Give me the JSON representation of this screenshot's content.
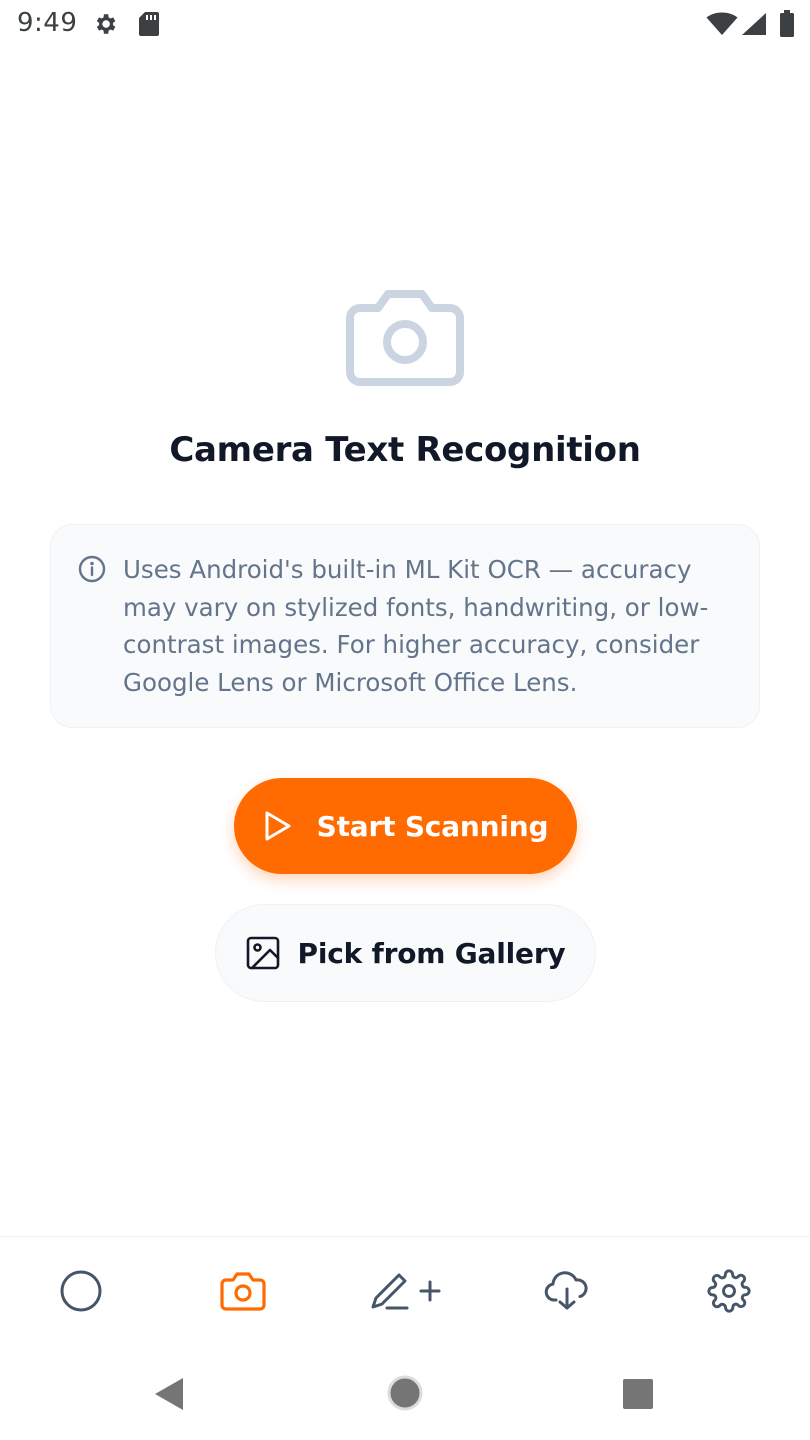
{
  "status_bar": {
    "time": "9:49",
    "icons": [
      "settings-gear-icon",
      "sd-card-icon",
      "wifi-icon",
      "signal-icon",
      "battery-icon"
    ]
  },
  "main": {
    "hero_icon": "camera-icon",
    "title": "Camera Text Recognition",
    "info": {
      "icon": "info-icon",
      "text": "Uses Android's built-in ML Kit OCR — accuracy may vary on stylized fonts, handwriting, or low-contrast images. For higher accuracy, consider Google Lens or Microsoft Office Lens."
    },
    "primary_button": {
      "label": "Start Scanning",
      "icon": "play-icon"
    },
    "secondary_button": {
      "label": "Pick from Gallery",
      "icon": "image-icon"
    }
  },
  "bottom_nav": {
    "items": [
      {
        "icon": "circle-icon",
        "active": false
      },
      {
        "icon": "camera-icon",
        "active": true
      },
      {
        "icon": "pen-plus-icon",
        "active": false
      },
      {
        "icon": "cloud-download-icon",
        "active": false
      },
      {
        "icon": "settings-gear-icon",
        "active": false
      }
    ]
  },
  "system_nav": {
    "buttons": [
      "back-icon",
      "home-icon",
      "recents-icon"
    ]
  },
  "colors": {
    "accent": "#ff6b00",
    "nav_inactive": "#475569",
    "text_primary": "#111827",
    "text_secondary": "#64748b",
    "card_bg": "#f8fafc"
  }
}
